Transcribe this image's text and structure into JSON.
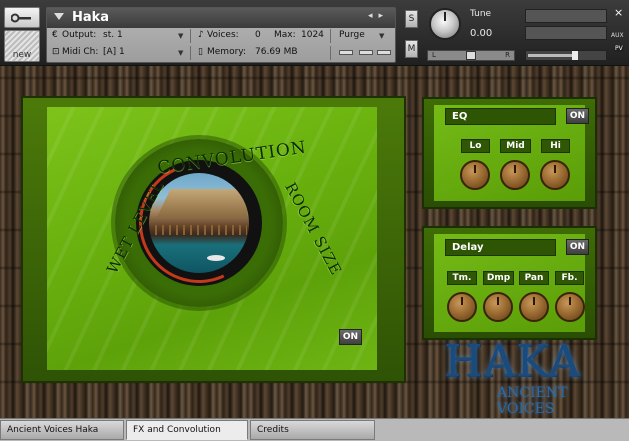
{
  "header": {
    "instrument_name": "Haka",
    "nav_prev": "◂",
    "nav_next": "▸",
    "output_label": "Output:",
    "output_value": "st. 1",
    "voices_label": "Voices:",
    "voices_value": "0",
    "max_label": "Max:",
    "max_value": "1024",
    "purge_label": "Purge",
    "midi_label": "Midi Ch:",
    "midi_value": "[A]  1",
    "memory_label": "Memory:",
    "memory_value": "76.69 MB",
    "new_label": "new",
    "solo_label": "S",
    "mute_label": "M",
    "tune_label": "Tune",
    "tune_value": "0.00",
    "pan_left": "L",
    "pan_right": "R",
    "aux_label": "AUX",
    "pv_label": "PV",
    "close_label": "×"
  },
  "convolution": {
    "title": "CONVOLUTION",
    "wet_level_label": "WET LEVEL",
    "room_size_label": "ROOM SIZE",
    "on_label": "ON"
  },
  "eq": {
    "title": "EQ",
    "on_label": "ON",
    "knobs": [
      "Lo",
      "Mid",
      "Hi"
    ]
  },
  "delay": {
    "title": "Delay",
    "on_label": "ON",
    "knobs": [
      "Tm.",
      "Dmp",
      "Pan",
      "Fb."
    ]
  },
  "logo": {
    "title": "HAKA",
    "subtitle": "ANCIENT VOICES"
  },
  "tabs": [
    "Ancient Voices Haka",
    "FX and Convolution",
    "Credits"
  ],
  "colors": {
    "panel_green": "#6eb513",
    "panel_dark_green": "#2e5504",
    "knob_bronze": "#9c6c33",
    "logo_blue": "#1a4b7e",
    "ring_red": "#c4391b"
  }
}
